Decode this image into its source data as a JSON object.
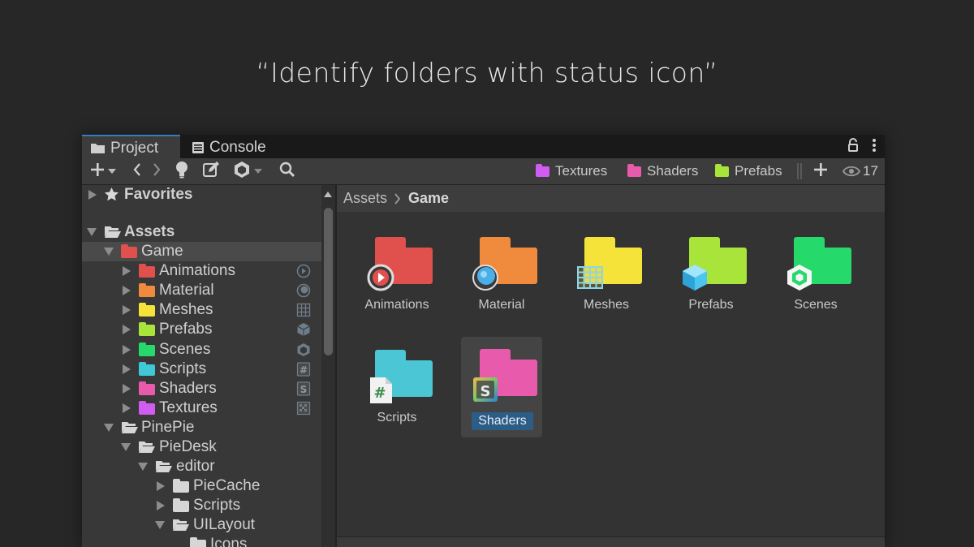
{
  "headline": "“Identify folders with status icon”",
  "tabs": [
    {
      "label": "Project",
      "icon": "folder-icon"
    },
    {
      "label": "Console",
      "icon": "console-icon"
    }
  ],
  "toolbar": {
    "favorites_filters": [
      {
        "label": "Textures",
        "color": "#d05cf0"
      },
      {
        "label": "Shaders",
        "color": "#e85aac"
      },
      {
        "label": "Prefabs",
        "color": "#a8e43a"
      }
    ],
    "visibility_count": "17"
  },
  "tree": {
    "favorites": "Favorites",
    "assets": "Assets",
    "game": "Game",
    "game_children": [
      {
        "label": "Animations",
        "color": "#e0504d",
        "icon": "play-icon"
      },
      {
        "label": "Material",
        "color": "#f08a3c",
        "icon": "sphere-icon"
      },
      {
        "label": "Meshes",
        "color": "#f5e33a",
        "icon": "grid-icon"
      },
      {
        "label": "Prefabs",
        "color": "#a8e43a",
        "icon": "cube-icon"
      },
      {
        "label": "Scenes",
        "color": "#25d96a",
        "icon": "unity-icon"
      },
      {
        "label": "Scripts",
        "color": "#3ec8d8",
        "icon": "hash-icon"
      },
      {
        "label": "Shaders",
        "color": "#e85aac",
        "icon": "shader-icon"
      },
      {
        "label": "Textures",
        "color": "#d05cf0",
        "icon": "texture-icon"
      }
    ],
    "pinepie": "PinePie",
    "piedesk": "PieDesk",
    "editor": "editor",
    "piecache": "PieCache",
    "scripts": "Scripts",
    "uilayout": "UILayout",
    "icons": "Icons"
  },
  "breadcrumb": {
    "root": "Assets",
    "current": "Game"
  },
  "grid_items": [
    {
      "label": "Animations",
      "color": "#e0504d"
    },
    {
      "label": "Material",
      "color": "#f08a3c"
    },
    {
      "label": "Meshes",
      "color": "#f5e33a"
    },
    {
      "label": "Prefabs",
      "color": "#a8e43a"
    },
    {
      "label": "Scenes",
      "color": "#25d96a"
    },
    {
      "label": "Scripts",
      "color": "#4bc6d4"
    },
    {
      "label": "Shaders",
      "color": "#e85aac"
    }
  ]
}
